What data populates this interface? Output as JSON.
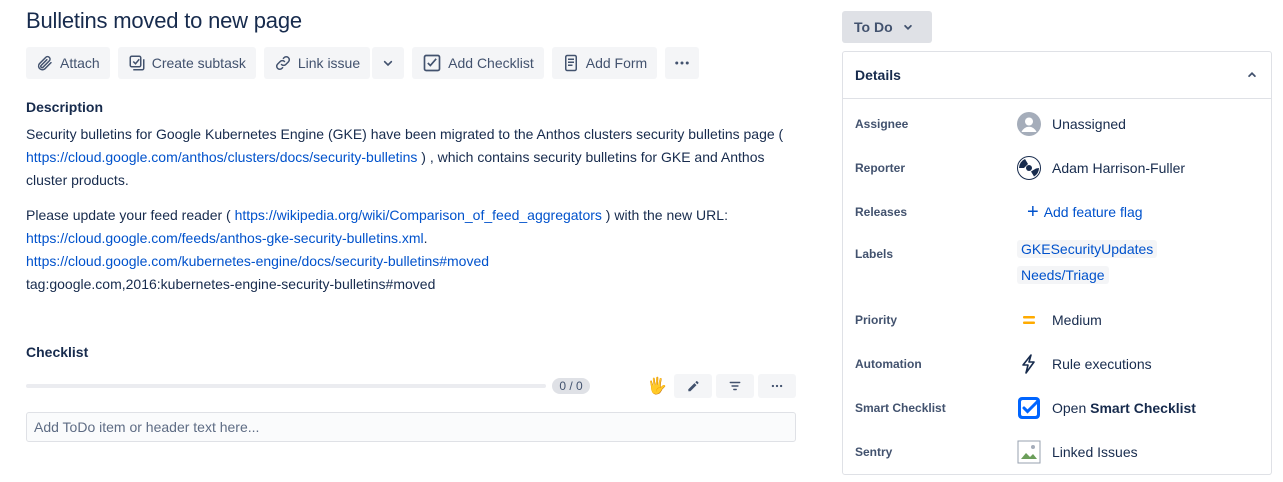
{
  "issue": {
    "title": "Bulletins moved to new page"
  },
  "toolbar": {
    "attach": "Attach",
    "create_subtask": "Create subtask",
    "link_issue": "Link issue",
    "add_checklist": "Add Checklist",
    "add_form": "Add Form"
  },
  "description": {
    "heading": "Description",
    "p1_a": "Security bulletins for Google Kubernetes Engine (GKE) have been migrated to the Anthos clusters security bulletins page ( ",
    "p1_link": "https://cloud.google.com/anthos/clusters/docs/security-bulletins",
    "p1_b": " ) , which contains security bulletins for GKE and Anthos cluster products.",
    "p2_a": "Please update your feed reader ( ",
    "p2_link": "https://wikipedia.org/wiki/Comparison_of_feed_aggregators",
    "p2_b": " ) with the new URL: ",
    "p2_link2": "https://cloud.google.com/feeds/anthos-gke-security-bulletins.xml",
    "p2_dot": ".",
    "link3": "https://cloud.google.com/kubernetes-engine/docs/security-bulletins#moved",
    "tag": "tag:google.com,2016:kubernetes-engine-security-bulletins#moved"
  },
  "checklist": {
    "heading": "Checklist",
    "progress_text": "0 / 0",
    "progress_fraction": 0,
    "input_placeholder": "Add ToDo item or header text here...",
    "hand_emoji": "🖐"
  },
  "status": {
    "label": "To Do"
  },
  "details": {
    "heading": "Details",
    "assignee_label": "Assignee",
    "assignee_value": "Unassigned",
    "reporter_label": "Reporter",
    "reporter_value": "Adam Harrison-Fuller",
    "releases_label": "Releases",
    "releases_value": "Add feature flag",
    "labels_label": "Labels",
    "labels": [
      "GKESecurityUpdates",
      "Needs/Triage"
    ],
    "priority_label": "Priority",
    "priority_value": "Medium",
    "automation_label": "Automation",
    "automation_value": "Rule executions",
    "smart_checklist_label": "Smart Checklist",
    "smart_checklist_prefix": "Open ",
    "smart_checklist_bold": "Smart Checklist",
    "sentry_label": "Sentry",
    "sentry_value": "Linked Issues"
  },
  "colors": {
    "link": "#0052cc",
    "text": "#172b4d",
    "priority_medium": "#ffab00",
    "smart_checklist_blue": "#0065ff"
  }
}
